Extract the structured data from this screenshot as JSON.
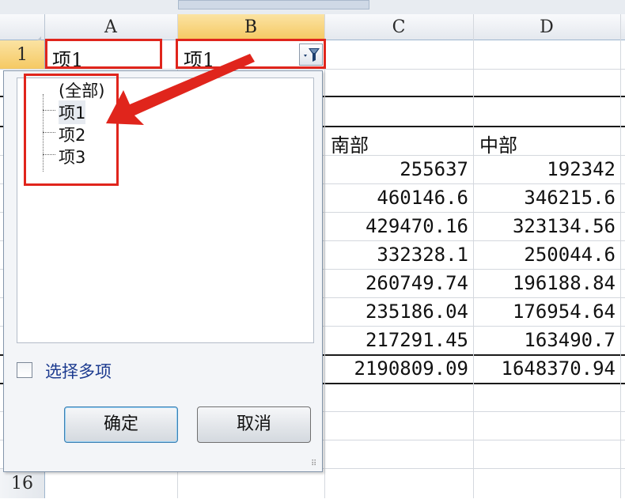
{
  "columns": [
    {
      "id": "corner",
      "label": ""
    },
    {
      "id": "A",
      "label": "A"
    },
    {
      "id": "B",
      "label": "B"
    },
    {
      "id": "C",
      "label": "C"
    },
    {
      "id": "D",
      "label": "D"
    }
  ],
  "rows": {
    "row1": "1",
    "row16": "16"
  },
  "cells": {
    "a1": "项1",
    "b1": "项1",
    "c_header": "南部",
    "d_header": "中部",
    "c_values": [
      "255637",
      "460146.6",
      "429470.16",
      "332328.1",
      "260749.74",
      "235186.04",
      "217291.45",
      "2190809.09"
    ],
    "d_values": [
      "192342",
      "346215.6",
      "323134.56",
      "250044.6",
      "196188.84",
      "176954.64",
      "163490.7",
      "1648370.94"
    ]
  },
  "filter_panel": {
    "items": [
      "(全部)",
      "项1",
      "项2",
      "项3"
    ],
    "multi_select_label": "选择多项",
    "multi_select_checked": false,
    "ok_label": "确定",
    "cancel_label": "取消"
  },
  "colors": {
    "highlight": "#e0251c",
    "selected_header": "#f5c963"
  }
}
